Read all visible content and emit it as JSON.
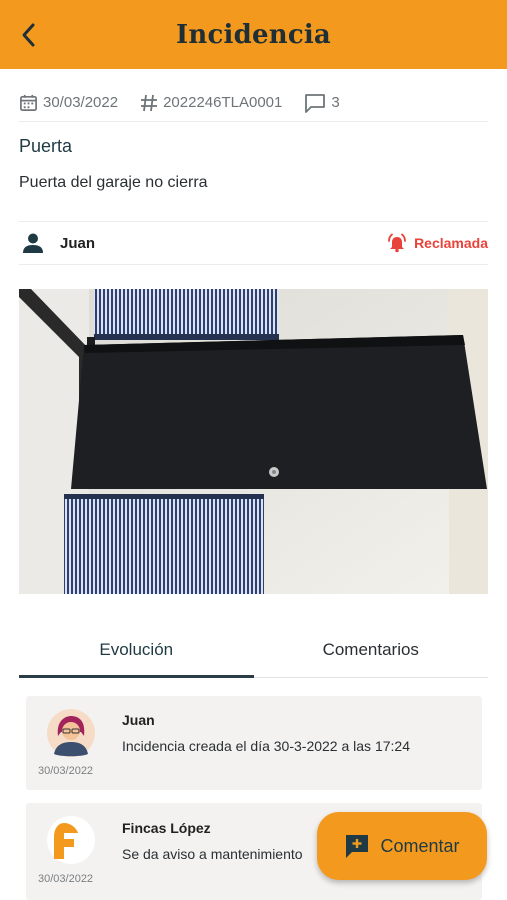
{
  "header": {
    "title": "Incidencia",
    "back_icon": "chevron-left-icon"
  },
  "meta": {
    "date": "30/03/2022",
    "reference": "2022246TLA0001",
    "comments_count": "3"
  },
  "incident": {
    "subject": "Puerta",
    "description": "Puerta del garaje no cierra",
    "user": "Juan",
    "status": "Reclamada"
  },
  "tabs": [
    {
      "label": "Evolución",
      "active": true
    },
    {
      "label": "Comentarios",
      "active": false
    }
  ],
  "timeline": [
    {
      "author": "Juan",
      "text": "Incidencia creada el día 30-3-2022 a las 17:24",
      "date": "30/03/2022"
    },
    {
      "author": "Fincas López",
      "text": "Se da aviso a mantenimiento",
      "date": "30/03/2022"
    }
  ],
  "fab": {
    "label": "Comentar"
  },
  "colors": {
    "accent": "#f39a1e",
    "alert": "#e8433a",
    "dark": "#1f3a44"
  }
}
